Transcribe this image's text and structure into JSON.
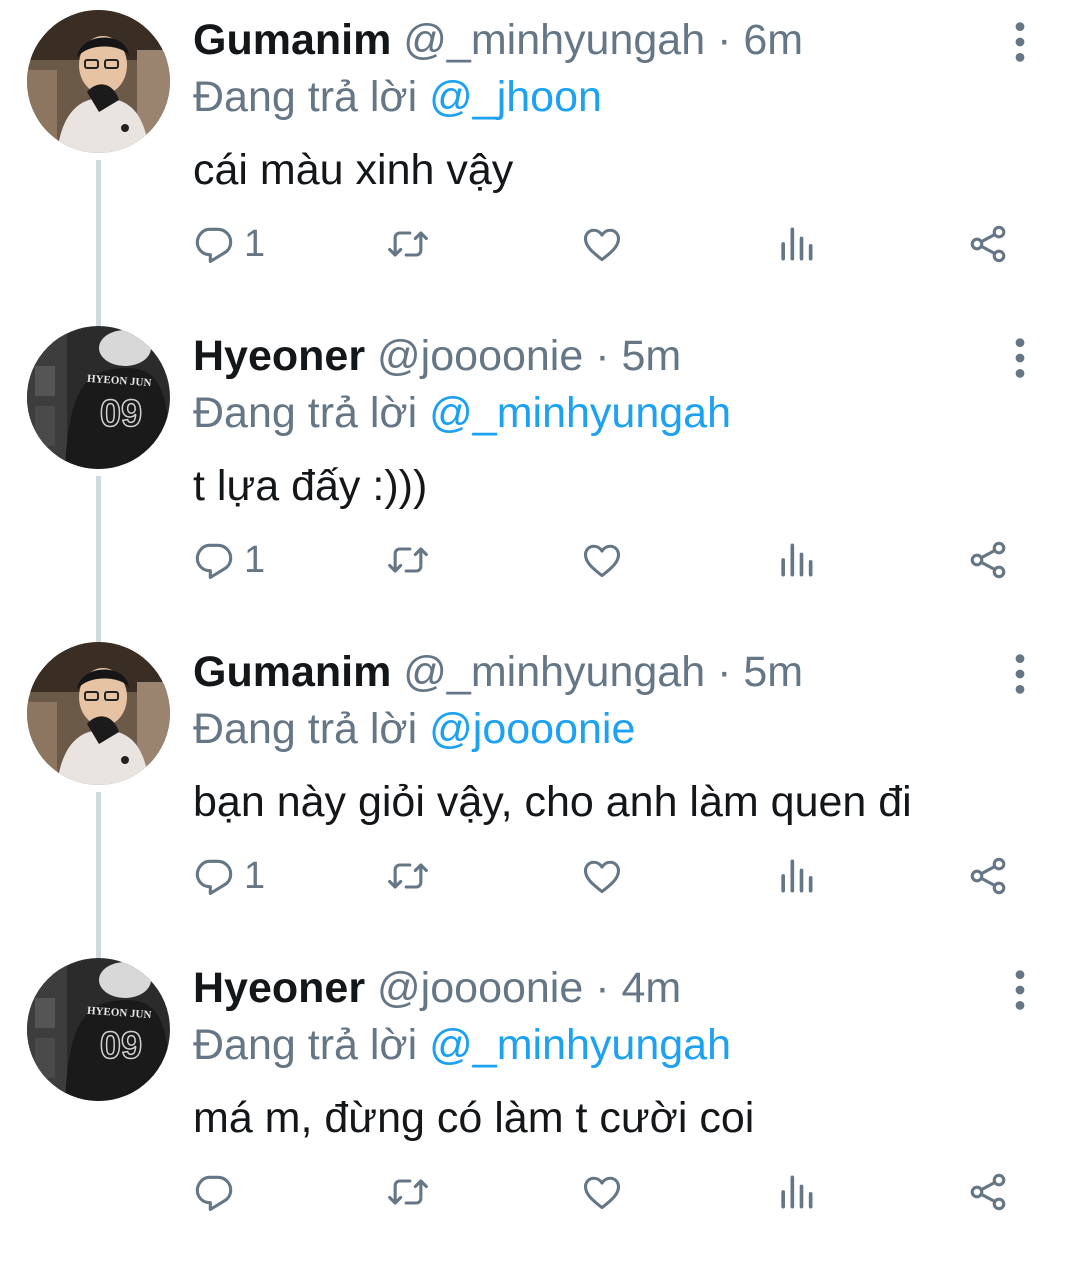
{
  "colors": {
    "name": "#14171a",
    "muted": "#657786",
    "mention": "#1da1f2",
    "thread": "#cfd9de"
  },
  "tweets": [
    {
      "name": "Gumanim",
      "handle": "@_minhyungah",
      "time": "· 6m",
      "replying_prefix": "Đang trả lời",
      "replying_to": "@_jhoon",
      "text": "cái màu xinh vậy",
      "reply_count": "1",
      "avatar": "gumanim-avatar"
    },
    {
      "name": "Hyeoner",
      "handle": "@joooonie",
      "time": "· 5m",
      "replying_prefix": "Đang trả lời",
      "replying_to": "@_minhyungah",
      "text": "t lựa đấy :)))",
      "reply_count": "1",
      "avatar": "hyeoner-avatar",
      "jersey_name": "HYEON JUN",
      "jersey_number": "09"
    },
    {
      "name": "Gumanim",
      "handle": "@_minhyungah",
      "time": "· 5m",
      "replying_prefix": "Đang trả lời",
      "replying_to": "@joooonie",
      "text": "bạn này giỏi vậy, cho anh làm quen đi",
      "reply_count": "1",
      "avatar": "gumanim-avatar"
    },
    {
      "name": "Hyeoner",
      "handle": "@joooonie",
      "time": "· 4m",
      "replying_prefix": "Đang trả lời",
      "replying_to": "@_minhyungah",
      "text": "má m, đừng có làm t cười coi",
      "reply_count": "",
      "avatar": "hyeoner-avatar",
      "jersey_name": "HYEON JUN",
      "jersey_number": "09"
    }
  ],
  "icons": {
    "reply": "reply-icon",
    "retweet": "retweet-icon",
    "like": "heart-icon",
    "analytics": "analytics-icon",
    "share": "share-icon",
    "more": "more-vertical-icon"
  }
}
